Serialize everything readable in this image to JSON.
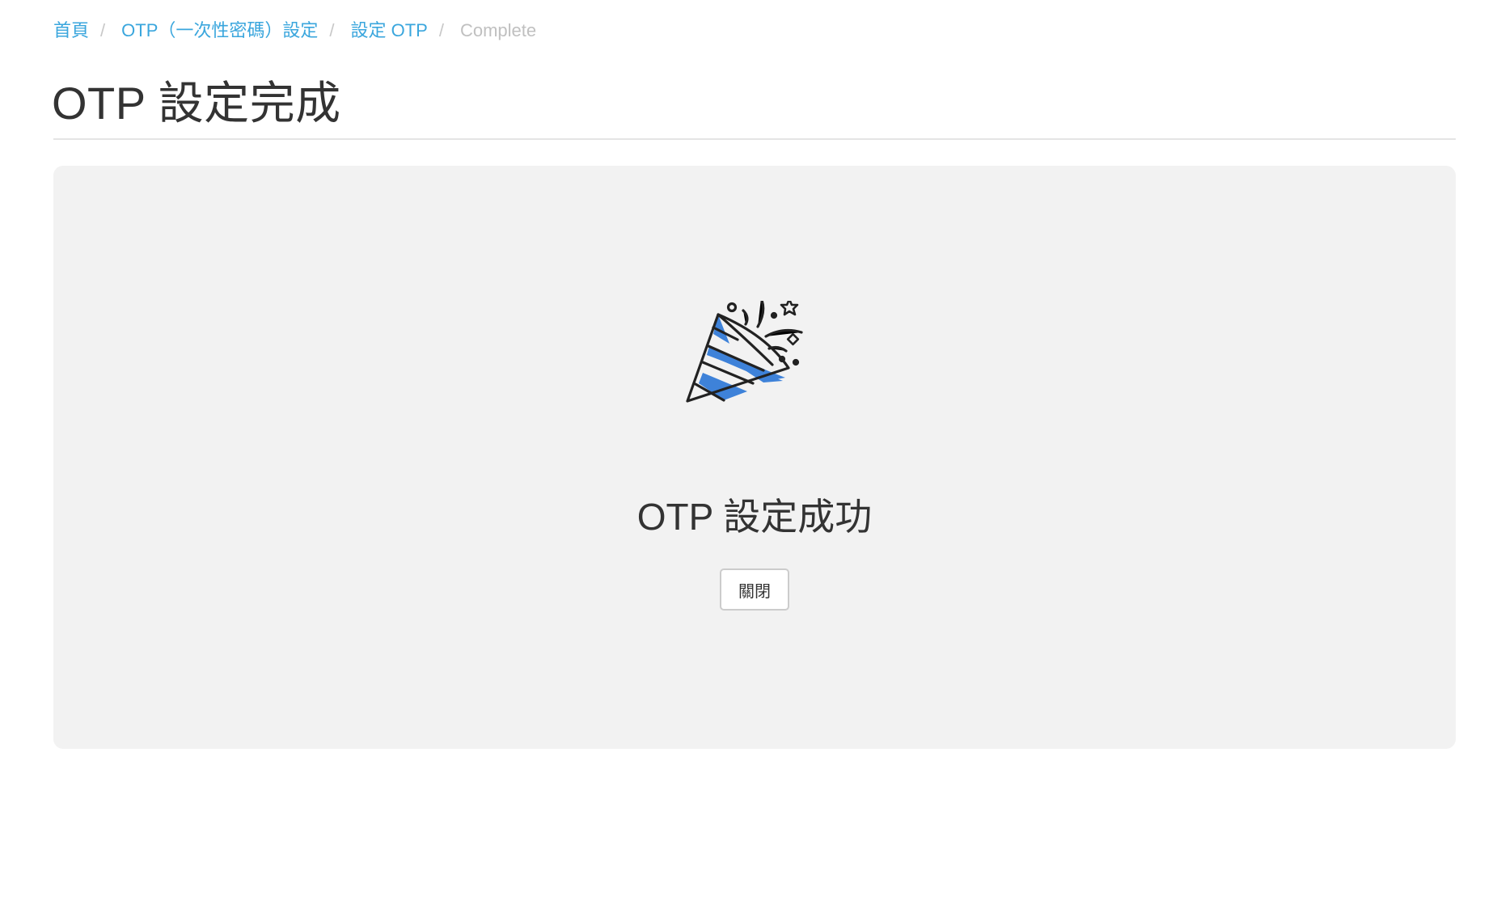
{
  "breadcrumb": {
    "items": [
      {
        "label": "首頁"
      },
      {
        "label": "OTP（一次性密碼）設定"
      },
      {
        "label": "設定 OTP"
      }
    ],
    "current": "Complete",
    "separator": "/"
  },
  "page": {
    "title": "OTP 設定完成"
  },
  "panel": {
    "icon": "party-popper-icon",
    "message": "OTP 設定成功",
    "close_label": "關閉"
  },
  "colors": {
    "link": "#3aa6dd",
    "accent_blue": "#3e82d9",
    "panel_bg": "#f2f2f2",
    "text": "#333333"
  }
}
